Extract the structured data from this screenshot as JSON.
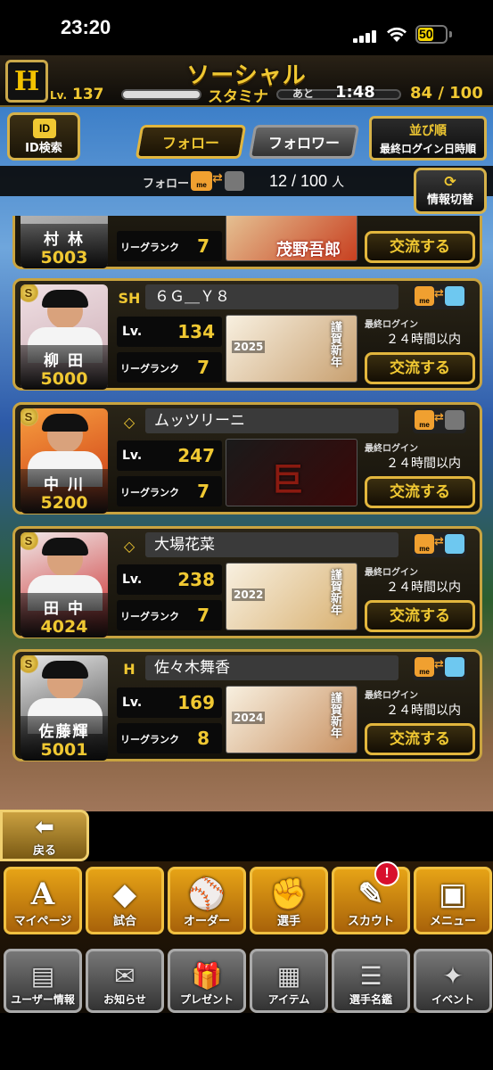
{
  "status": {
    "time": "23:20",
    "battery": "50"
  },
  "header": {
    "title": "ソーシャル",
    "level_prefix": "Lv.",
    "level": "137",
    "stamina_label": "スタミナ",
    "ato_label": "あと",
    "stamina_time": "1:48",
    "stamina_value": "84 / 100"
  },
  "controls": {
    "id_search": "ID検索",
    "tab_follow": "フォロー",
    "tab_follower": "フォロワー",
    "sort_label": "並び順",
    "sort_value": "最終ログイン日時順",
    "follow_label": "フォロー",
    "me_label": "me",
    "follow_count": "12 / 100",
    "follow_unit": "人",
    "info_switch": "情報切替"
  },
  "labels": {
    "lv": "Lv.",
    "league_rank": "リーグランク",
    "last_login": "最終ログイン",
    "exchange": "交流する"
  },
  "partial_card": {
    "name": "村 林",
    "power": "5003",
    "rank": "7",
    "banner_text": "茂野吾郎"
  },
  "cards": [
    {
      "name": "柳 田",
      "power": "5000",
      "team_icon": "hawks-icon",
      "team_mark": "SH",
      "username": "６Ｇ＿Ｙ８",
      "level": "134",
      "rank": "7",
      "banner_year": "2025",
      "banner_text": "謹賀新年",
      "last_login": "２４時間以内",
      "partner_color": "#6ec8f0"
    },
    {
      "name": "中 川",
      "power": "5200",
      "team_icon": "giants-icon",
      "team_mark": "◇",
      "username": "ムッツリーニ",
      "level": "247",
      "rank": "7",
      "banner_year": "",
      "banner_text": "巨",
      "last_login": "２４時間以内",
      "partner_color": "#777777"
    },
    {
      "name": "田 中",
      "power": "4024",
      "team_icon": "giants-icon",
      "team_mark": "◇",
      "username": "大場花菜",
      "level": "238",
      "rank": "7",
      "banner_year": "2022",
      "banner_text": "謹賀新年",
      "last_login": "２４時間以内",
      "partner_color": "#6ec8f0"
    },
    {
      "name": "佐藤輝",
      "power": "5001",
      "team_icon": "tigers-icon",
      "team_mark": "H",
      "username": "佐々木舞香",
      "level": "169",
      "rank": "8",
      "banner_year": "2024",
      "banner_text": "謹賀新年",
      "last_login": "２４時間以内",
      "partner_color": "#6ec8f0"
    }
  ],
  "back_label": "戻る",
  "nav_main": [
    {
      "label": "マイページ",
      "icon": "A"
    },
    {
      "label": "試合",
      "icon": "◆"
    },
    {
      "label": "オーダー",
      "icon": "⚾"
    },
    {
      "label": "選手",
      "icon": "✊"
    },
    {
      "label": "スカウト",
      "icon": "✎"
    },
    {
      "label": "メニュー",
      "icon": "▣"
    }
  ],
  "scout_badge": "!",
  "nav_sub": [
    {
      "label": "ユーザー情報",
      "icon": "▤"
    },
    {
      "label": "お知らせ",
      "icon": "✉"
    },
    {
      "label": "プレゼント",
      "icon": "🎁"
    },
    {
      "label": "アイテム",
      "icon": "▦"
    },
    {
      "label": "選手名鑑",
      "icon": "☰"
    },
    {
      "label": "イベント",
      "icon": "✦"
    }
  ]
}
